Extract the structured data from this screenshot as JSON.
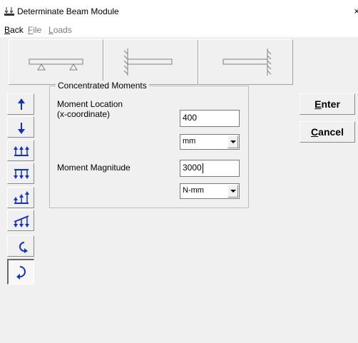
{
  "window": {
    "title": "Determinate Beam Module",
    "close_glyph": "×",
    "icon": "beam-app-icon"
  },
  "menu": {
    "items": [
      {
        "accel": "B",
        "rest": "ack",
        "enabled": true
      },
      {
        "accel": "F",
        "rest": "ile",
        "enabled": false
      },
      {
        "accel": "L",
        "rest": "oads",
        "enabled": false
      }
    ]
  },
  "beam_types": [
    {
      "icon": "simply-supported-beam-icon"
    },
    {
      "icon": "fixed-left-cantilever-icon"
    },
    {
      "icon": "fixed-right-cantilever-icon"
    }
  ],
  "load_tools": [
    {
      "icon": "point-load-up-icon",
      "pressed": false
    },
    {
      "icon": "point-load-down-icon",
      "pressed": false
    },
    {
      "icon": "uniform-load-up-icon",
      "pressed": false
    },
    {
      "icon": "uniform-load-down-icon",
      "pressed": false
    },
    {
      "icon": "linear-load-up-icon",
      "pressed": false
    },
    {
      "icon": "linear-load-down-icon",
      "pressed": false
    },
    {
      "icon": "moment-counterclockwise-icon",
      "pressed": false
    },
    {
      "icon": "moment-clockwise-icon",
      "pressed": true
    }
  ],
  "form": {
    "group_title": "Concentrated Moments",
    "location_label_line1": "Moment Location",
    "location_label_line2": "(x-coordinate)",
    "location_value": "400",
    "location_unit": "mm",
    "magnitude_label": "Moment Magnitude",
    "magnitude_value": "3000",
    "magnitude_unit": "N-mm"
  },
  "actions": {
    "enter": {
      "accel": "E",
      "rest": "nter"
    },
    "cancel": {
      "accel": "C",
      "rest": "ancel"
    }
  },
  "colors": {
    "icon_blue": "#1030d0",
    "icon_gray": "#808080",
    "window_bg": "#f0f0f0"
  }
}
